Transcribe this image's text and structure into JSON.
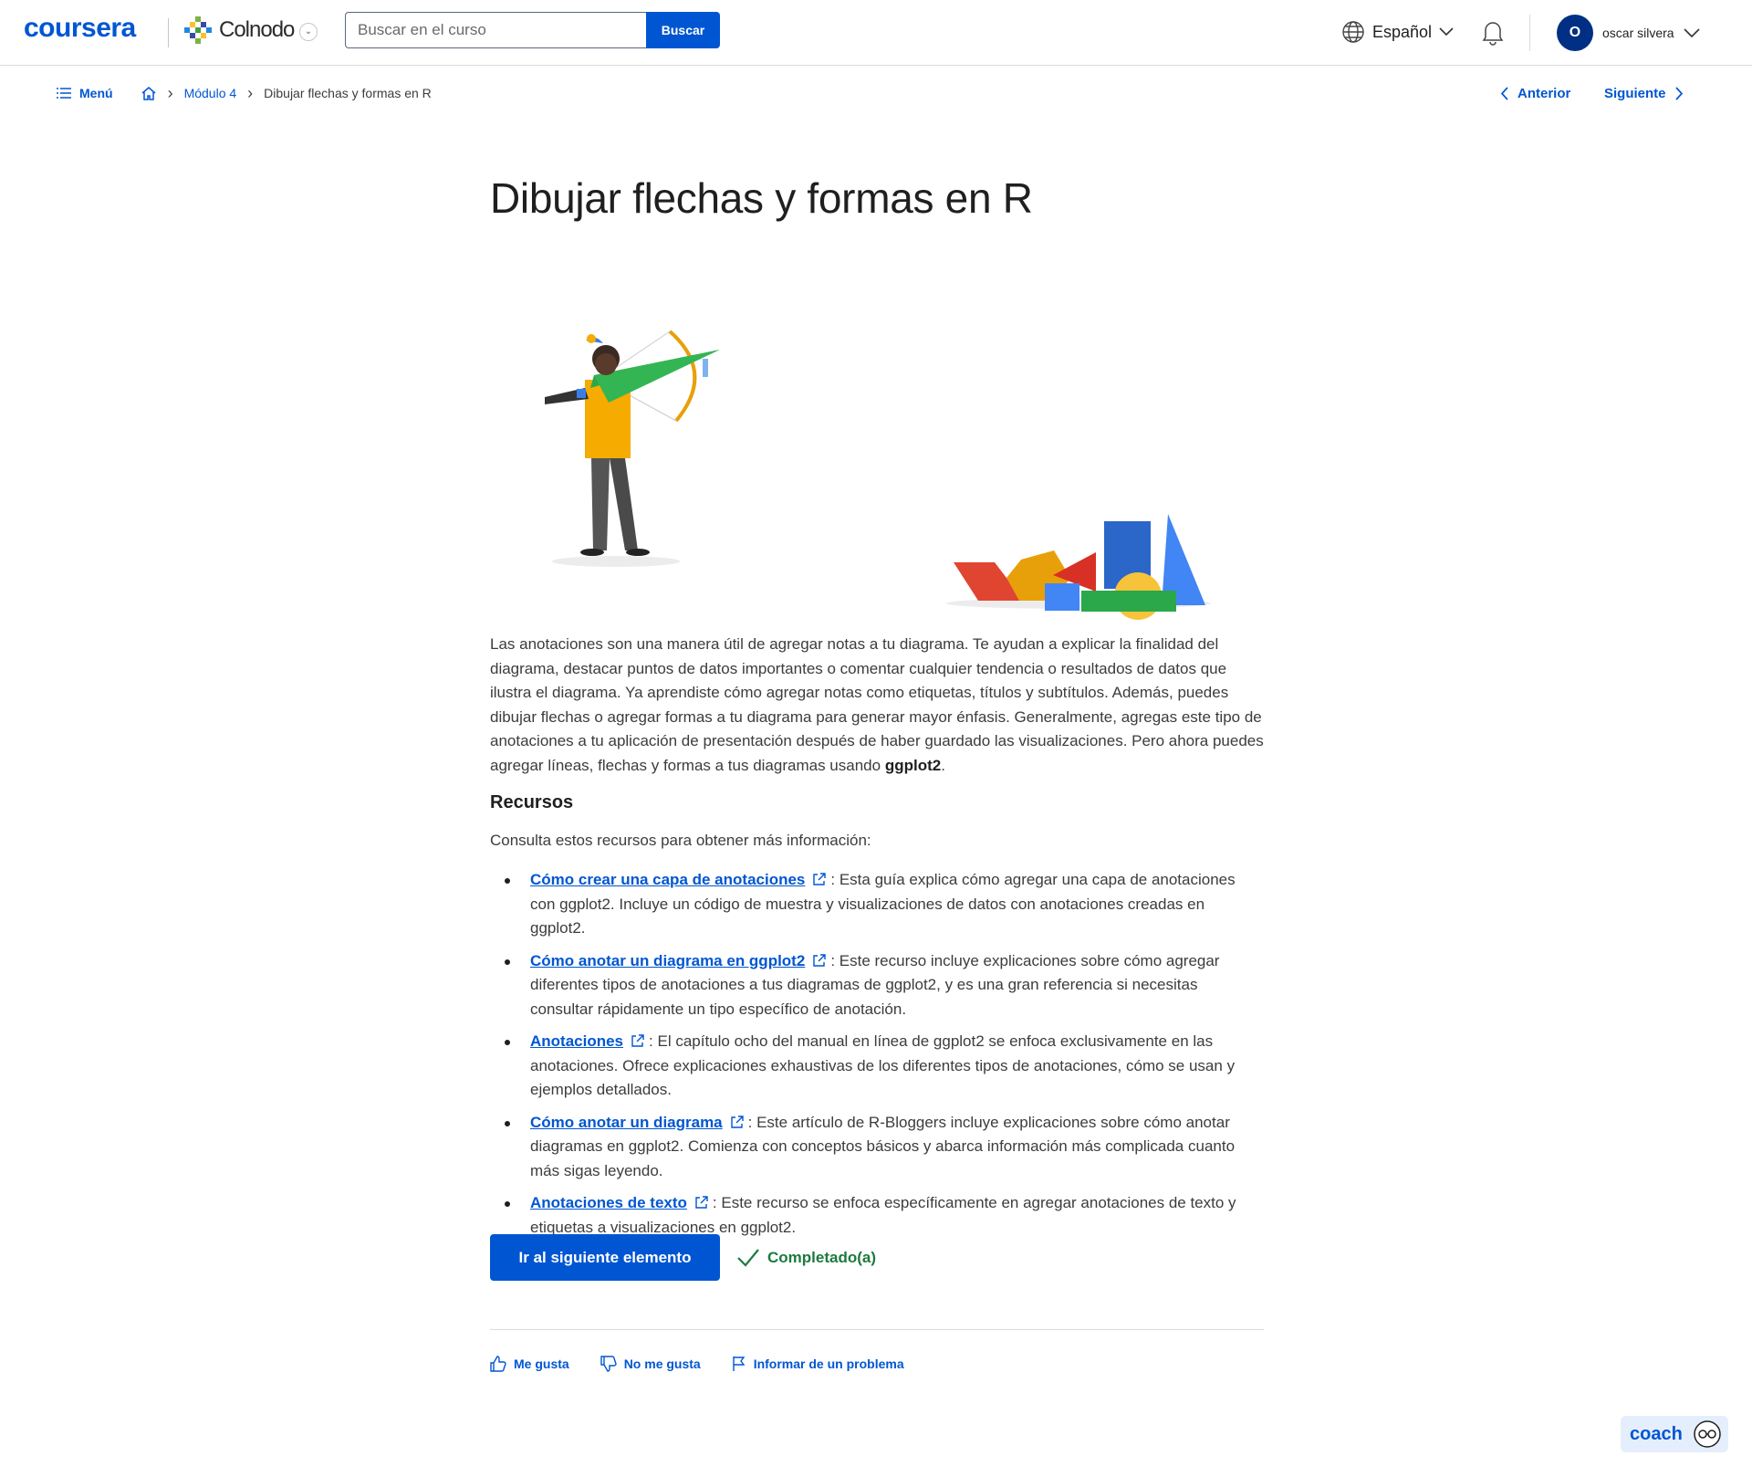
{
  "header": {
    "logo": "coursera",
    "partner": "Colnodo",
    "search_placeholder": "Buscar en el curso",
    "search_button": "Buscar",
    "language": "Español",
    "user_initial": "O",
    "user_name": "oscar silvera"
  },
  "breadcrumb": {
    "menu": "Menú",
    "module": "Módulo 4",
    "current": "Dibujar flechas y formas en R",
    "prev": "Anterior",
    "next": "Siguiente"
  },
  "content": {
    "title": "Dibujar flechas y formas en R",
    "paragraph": "Las anotaciones son una manera útil de agregar notas a tu diagrama. Te ayudan a explicar la finalidad del diagrama, destacar puntos de datos importantes o comentar cualquier tendencia o resultados de datos que ilustra el diagrama. Ya aprendiste cómo agregar notas como etiquetas, títulos y subtítulos. Además, puedes dibujar flechas o agregar formas a tu diagrama para generar mayor énfasis. Generalmente, agregas este tipo de anotaciones a tu aplicación de presentación después de haber guardado las visualizaciones. Pero ahora puedes agregar líneas, flechas y formas a tus diagramas usando",
    "paragraph_bold": "ggplot2",
    "paragraph_end": ".",
    "resources_heading": "Recursos",
    "resources_intro": "Consulta estos recursos para obtener más información:",
    "resources": [
      {
        "link": "Cómo crear una capa de anotaciones",
        "text": ": Esta guía explica cómo agregar una capa de anotaciones con ggplot2. Incluye un código de muestra y visualizaciones de datos con anotaciones creadas en ggplot2."
      },
      {
        "link": "Cómo anotar un diagrama en ggplot2",
        "text": ": Este recurso incluye explicaciones sobre cómo agregar diferentes tipos de anotaciones a tus diagramas de ggplot2, y es una gran referencia si necesitas consultar rápidamente un tipo específico de anotación."
      },
      {
        "link": "Anotaciones",
        "text": ": El capítulo ocho del manual en línea de ggplot2 se enfoca exclusivamente en las anotaciones. Ofrece explicaciones exhaustivas de los diferentes tipos de anotaciones, cómo se usan y ejemplos detallados."
      },
      {
        "link": "Cómo anotar un diagrama",
        "text": ": Este artículo de R-Bloggers incluye explicaciones sobre cómo anotar diagramas en ggplot2. Comienza con conceptos básicos y abarca información más complicada cuanto más sigas leyendo."
      },
      {
        "link": "Anotaciones de texto",
        "text": ": Este recurso se enfoca específicamente en agregar anotaciones de texto y etiquetas a visualizaciones en ggplot2."
      }
    ]
  },
  "actions": {
    "next_item": "Ir al siguiente elemento",
    "completed": "Completado(a)"
  },
  "feedback": {
    "like": "Me gusta",
    "dislike": "No me gusta",
    "report": "Informar de un problema"
  },
  "coach": {
    "label": "coach"
  },
  "colors": {
    "primary": "#0056d2",
    "success": "#1c7a3d",
    "avatar": "#002f83"
  }
}
